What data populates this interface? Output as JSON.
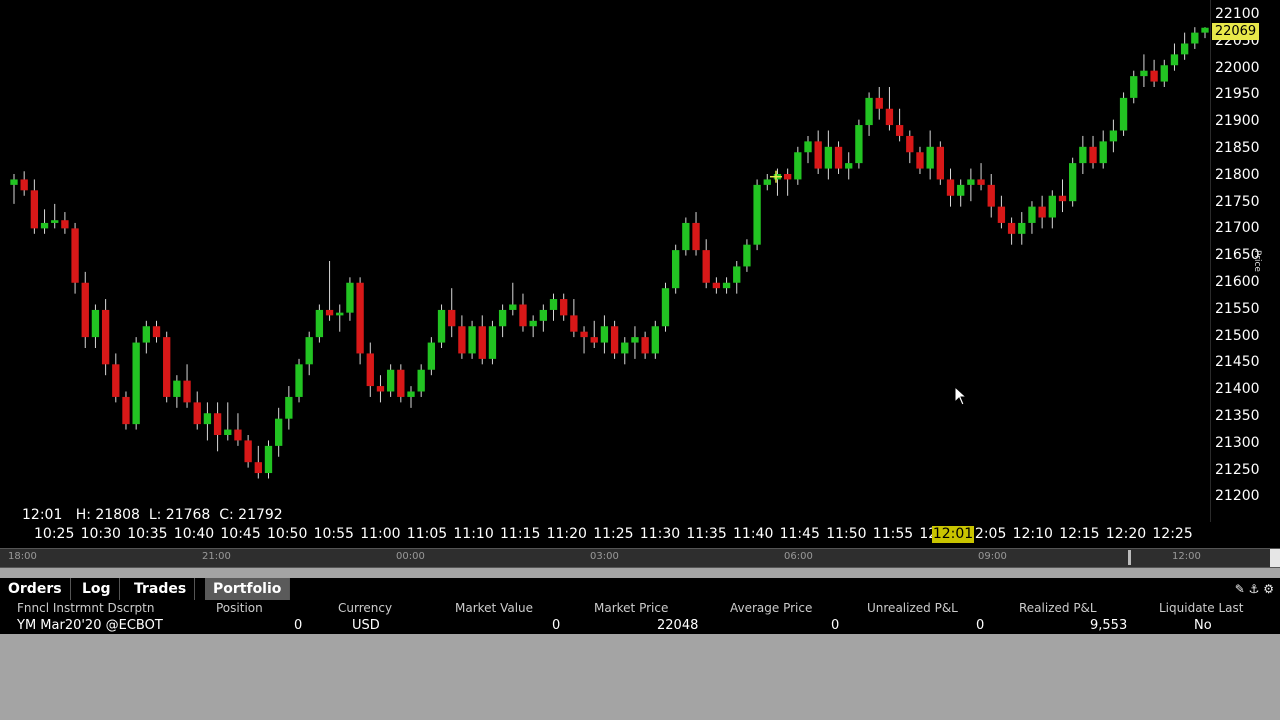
{
  "chart": {
    "price_ticks": [
      "22100",
      "22050",
      "22000",
      "21950",
      "21900",
      "21850",
      "21800",
      "21750",
      "21700",
      "21650",
      "21600",
      "21550",
      "21500",
      "21450",
      "21400",
      "21350",
      "21300",
      "21250",
      "21200"
    ],
    "last_price": "22069",
    "axis_label": "Price",
    "ohlc_text": "12:01   H: 21808  L: 21768  C: 21792",
    "time_ticks": [
      "10:25",
      "10:30",
      "10:35",
      "10:40",
      "10:45",
      "10:50",
      "10:55",
      "11:00",
      "11:05",
      "11:10",
      "11:15",
      "11:20",
      "11:25",
      "11:30",
      "11:35",
      "11:40",
      "11:45",
      "11:50",
      "11:55",
      "12:00",
      "12:05",
      "12:10",
      "12:15",
      "12:20",
      "12:25"
    ],
    "time_marker": "12:01",
    "overview_ticks": [
      "18:00",
      "21:00",
      "00:00",
      "03:00",
      "06:00",
      "09:00",
      "12:00"
    ],
    "colors": {
      "up": "#22c322",
      "down": "#d81818",
      "background": "#000000"
    }
  },
  "chart_data": {
    "type": "candlestick",
    "ylim": [
      21160,
      22120
    ],
    "candles": [
      [
        21780,
        21800,
        21745,
        21790
      ],
      [
        21790,
        21805,
        21760,
        21770
      ],
      [
        21770,
        21790,
        21690,
        21700
      ],
      [
        21700,
        21735,
        21690,
        21710
      ],
      [
        21710,
        21745,
        21700,
        21715
      ],
      [
        21715,
        21730,
        21690,
        21700
      ],
      [
        21700,
        21710,
        21580,
        21600
      ],
      [
        21600,
        21620,
        21480,
        21500
      ],
      [
        21500,
        21560,
        21480,
        21550
      ],
      [
        21550,
        21570,
        21430,
        21450
      ],
      [
        21450,
        21470,
        21380,
        21390
      ],
      [
        21390,
        21400,
        21330,
        21340
      ],
      [
        21340,
        21500,
        21330,
        21490
      ],
      [
        21490,
        21530,
        21470,
        21520
      ],
      [
        21520,
        21530,
        21490,
        21500
      ],
      [
        21500,
        21510,
        21380,
        21390
      ],
      [
        21390,
        21430,
        21370,
        21420
      ],
      [
        21420,
        21450,
        21370,
        21380
      ],
      [
        21380,
        21400,
        21330,
        21340
      ],
      [
        21340,
        21380,
        21310,
        21360
      ],
      [
        21360,
        21380,
        21290,
        21320
      ],
      [
        21320,
        21380,
        21310,
        21330
      ],
      [
        21330,
        21360,
        21300,
        21310
      ],
      [
        21310,
        21320,
        21260,
        21270
      ],
      [
        21270,
        21300,
        21240,
        21250
      ],
      [
        21250,
        21310,
        21240,
        21300
      ],
      [
        21300,
        21370,
        21280,
        21350
      ],
      [
        21350,
        21410,
        21330,
        21390
      ],
      [
        21390,
        21460,
        21380,
        21450
      ],
      [
        21450,
        21510,
        21430,
        21500
      ],
      [
        21500,
        21560,
        21490,
        21550
      ],
      [
        21550,
        21640,
        21530,
        21540
      ],
      [
        21540,
        21560,
        21510,
        21545
      ],
      [
        21545,
        21610,
        21530,
        21600
      ],
      [
        21600,
        21610,
        21450,
        21470
      ],
      [
        21470,
        21490,
        21390,
        21410
      ],
      [
        21410,
        21430,
        21380,
        21400
      ],
      [
        21400,
        21450,
        21390,
        21440
      ],
      [
        21440,
        21450,
        21380,
        21390
      ],
      [
        21390,
        21410,
        21370,
        21400
      ],
      [
        21400,
        21450,
        21390,
        21440
      ],
      [
        21440,
        21500,
        21430,
        21490
      ],
      [
        21490,
        21560,
        21480,
        21550
      ],
      [
        21550,
        21590,
        21500,
        21520
      ],
      [
        21520,
        21540,
        21460,
        21470
      ],
      [
        21470,
        21530,
        21460,
        21520
      ],
      [
        21520,
        21540,
        21450,
        21460
      ],
      [
        21460,
        21530,
        21450,
        21520
      ],
      [
        21520,
        21560,
        21500,
        21550
      ],
      [
        21550,
        21600,
        21540,
        21560
      ],
      [
        21560,
        21580,
        21510,
        21520
      ],
      [
        21520,
        21540,
        21500,
        21530
      ],
      [
        21530,
        21560,
        21510,
        21550
      ],
      [
        21550,
        21580,
        21530,
        21570
      ],
      [
        21570,
        21580,
        21530,
        21540
      ],
      [
        21540,
        21570,
        21500,
        21510
      ],
      [
        21510,
        21520,
        21470,
        21500
      ],
      [
        21500,
        21530,
        21480,
        21490
      ],
      [
        21490,
        21540,
        21470,
        21520
      ],
      [
        21520,
        21530,
        21460,
        21470
      ],
      [
        21470,
        21500,
        21450,
        21490
      ],
      [
        21490,
        21520,
        21460,
        21500
      ],
      [
        21500,
        21510,
        21460,
        21470
      ],
      [
        21470,
        21530,
        21460,
        21520
      ],
      [
        21520,
        21600,
        21510,
        21590
      ],
      [
        21590,
        21670,
        21580,
        21660
      ],
      [
        21660,
        21720,
        21650,
        21710
      ],
      [
        21710,
        21730,
        21650,
        21660
      ],
      [
        21660,
        21680,
        21590,
        21600
      ],
      [
        21600,
        21610,
        21580,
        21590
      ],
      [
        21590,
        21610,
        21580,
        21600
      ],
      [
        21600,
        21640,
        21580,
        21630
      ],
      [
        21630,
        21680,
        21620,
        21670
      ],
      [
        21670,
        21790,
        21660,
        21780
      ],
      [
        21780,
        21800,
        21770,
        21790
      ],
      [
        21790,
        21810,
        21760,
        21800
      ],
      [
        21800,
        21810,
        21760,
        21790
      ],
      [
        21790,
        21850,
        21780,
        21840
      ],
      [
        21840,
        21870,
        21820,
        21860
      ],
      [
        21860,
        21880,
        21800,
        21810
      ],
      [
        21810,
        21880,
        21790,
        21850
      ],
      [
        21850,
        21860,
        21800,
        21810
      ],
      [
        21810,
        21840,
        21790,
        21820
      ],
      [
        21820,
        21900,
        21810,
        21890
      ],
      [
        21890,
        21950,
        21870,
        21940
      ],
      [
        21940,
        21960,
        21900,
        21920
      ],
      [
        21920,
        21960,
        21880,
        21890
      ],
      [
        21890,
        21920,
        21860,
        21870
      ],
      [
        21870,
        21880,
        21820,
        21840
      ],
      [
        21840,
        21850,
        21800,
        21810
      ],
      [
        21810,
        21880,
        21790,
        21850
      ],
      [
        21850,
        21860,
        21780,
        21790
      ],
      [
        21790,
        21810,
        21740,
        21760
      ],
      [
        21760,
        21790,
        21740,
        21780
      ],
      [
        21780,
        21810,
        21750,
        21790
      ],
      [
        21790,
        21820,
        21770,
        21780
      ],
      [
        21780,
        21800,
        21720,
        21740
      ],
      [
        21740,
        21760,
        21700,
        21710
      ],
      [
        21710,
        21720,
        21670,
        21690
      ],
      [
        21690,
        21730,
        21670,
        21710
      ],
      [
        21710,
        21750,
        21690,
        21740
      ],
      [
        21740,
        21760,
        21700,
        21720
      ],
      [
        21720,
        21770,
        21700,
        21760
      ],
      [
        21760,
        21790,
        21730,
        21750
      ],
      [
        21750,
        21830,
        21740,
        21820
      ],
      [
        21820,
        21870,
        21800,
        21850
      ],
      [
        21850,
        21870,
        21810,
        21820
      ],
      [
        21820,
        21880,
        21810,
        21860
      ],
      [
        21860,
        21900,
        21840,
        21880
      ],
      [
        21880,
        21950,
        21870,
        21940
      ],
      [
        21940,
        21990,
        21930,
        21980
      ],
      [
        21980,
        22020,
        21960,
        21990
      ],
      [
        21990,
        22010,
        21960,
        21970
      ],
      [
        21970,
        22010,
        21960,
        22000
      ],
      [
        22000,
        22040,
        21990,
        22020
      ],
      [
        22020,
        22060,
        22010,
        22040
      ],
      [
        22040,
        22070,
        22030,
        22060
      ],
      [
        22060,
        22070,
        22050,
        22069
      ]
    ]
  },
  "panel": {
    "tabs": [
      "Orders",
      "Log",
      "Trades",
      "Portfolio"
    ],
    "active_tab": "Portfolio",
    "columns": [
      "Fnncl Instrmnt Dscrptn",
      "Position",
      "Currency",
      "Market Value",
      "Market Price",
      "Average Price",
      "Unrealized P&L",
      "Realized P&L",
      "Liquidate Last"
    ],
    "row": {
      "instrument": "YM Mar20'20 @ECBOT",
      "position": "0",
      "currency": "USD",
      "market_value": "0",
      "market_price": "22048",
      "average_price": "0",
      "unrealized_pnl": "0",
      "realized_pnl": "9,553",
      "liquidate_last": "No"
    }
  }
}
